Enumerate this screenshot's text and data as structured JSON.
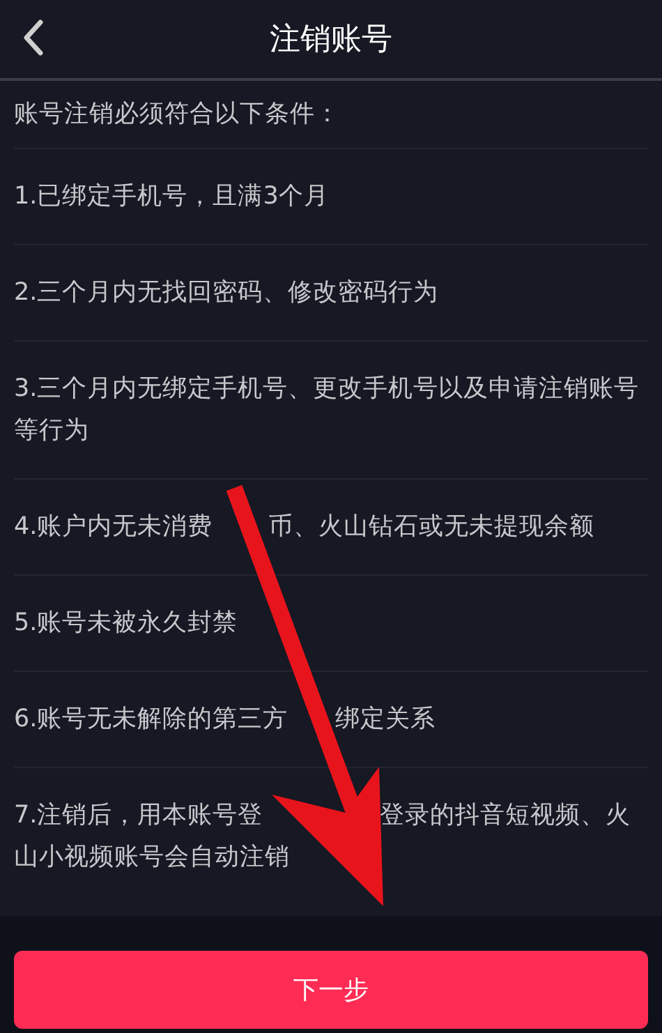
{
  "header": {
    "title": "注销账号"
  },
  "intro": "账号注销必须符合以下条件：",
  "conditions": [
    {
      "parts": [
        "1.已绑定手机号，且满3个月"
      ]
    },
    {
      "parts": [
        "2.三个月内无找回密码、修改密码行为"
      ]
    },
    {
      "parts": [
        "3.三个月内无绑定手机号、更改手机号以及申请注销账号等行为"
      ]
    },
    {
      "parts": [
        "4.账户内无未消费",
        "币、火山钻石或无未提现余额"
      ]
    },
    {
      "parts": [
        "5.账号未被永久封禁"
      ]
    },
    {
      "parts": [
        "6.账号无未解除的第三方",
        "绑定关系"
      ]
    },
    {
      "parts": [
        "7.注销后，用本账号登",
        "登录的抖音短视频、火山小视频账号会自动注销"
      ]
    }
  ],
  "next_button": "下一步"
}
